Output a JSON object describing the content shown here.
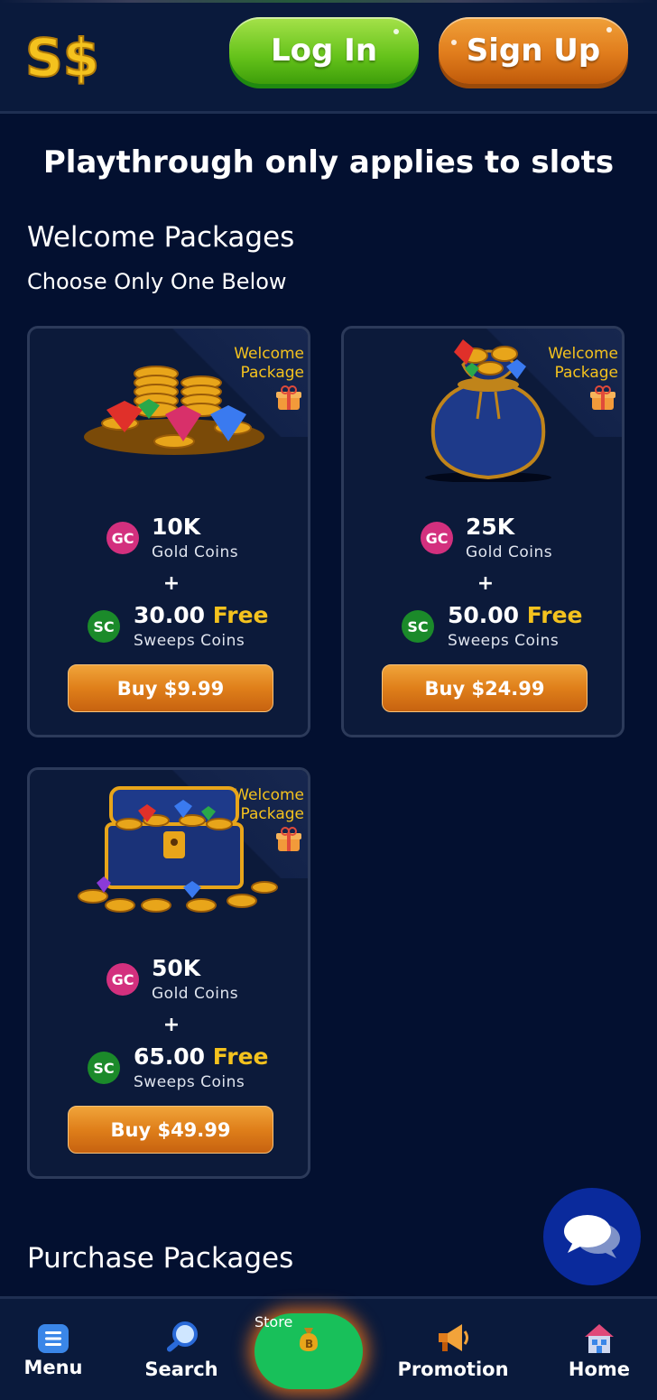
{
  "header": {
    "login_label": "Log In",
    "signup_label": "Sign Up"
  },
  "notice": "Playthrough only applies to slots",
  "welcome": {
    "title": "Welcome Packages",
    "subtitle": "Choose Only One Below",
    "badge_line1": "Welcome",
    "badge_line2": "Package",
    "packages": [
      {
        "gc_amount": "10K",
        "gc_label": "Gold Coins",
        "sc_amount": "30.00",
        "sc_free": "Free",
        "sc_label": "Sweeps Coins",
        "buy_label": "Buy $9.99",
        "art": "coins-gems"
      },
      {
        "gc_amount": "25K",
        "gc_label": "Gold Coins",
        "sc_amount": "50.00",
        "sc_free": "Free",
        "sc_label": "Sweeps Coins",
        "buy_label": "Buy $24.99",
        "art": "coin-sack"
      },
      {
        "gc_amount": "50K",
        "gc_label": "Gold Coins",
        "sc_amount": "65.00",
        "sc_free": "Free",
        "sc_label": "Sweeps Coins",
        "buy_label": "Buy $49.99",
        "art": "treasure-chest"
      }
    ]
  },
  "coin_badges": {
    "gc": "GC",
    "sc": "SC"
  },
  "plus": "+",
  "purchase": {
    "title": "Purchase Packages"
  },
  "nav": {
    "menu": "Menu",
    "search": "Search",
    "store": "Store",
    "promotion": "Promotion",
    "home": "Home"
  },
  "colors": {
    "background": "#031030",
    "accent_gold": "#f4c21e",
    "gc_pink": "#d3307e",
    "sc_green": "#1b8a2a",
    "buy_orange": "#df7f1a",
    "login_green": "#64c21a",
    "signup_orange": "#e07c1c",
    "store_green": "#18c05a"
  }
}
